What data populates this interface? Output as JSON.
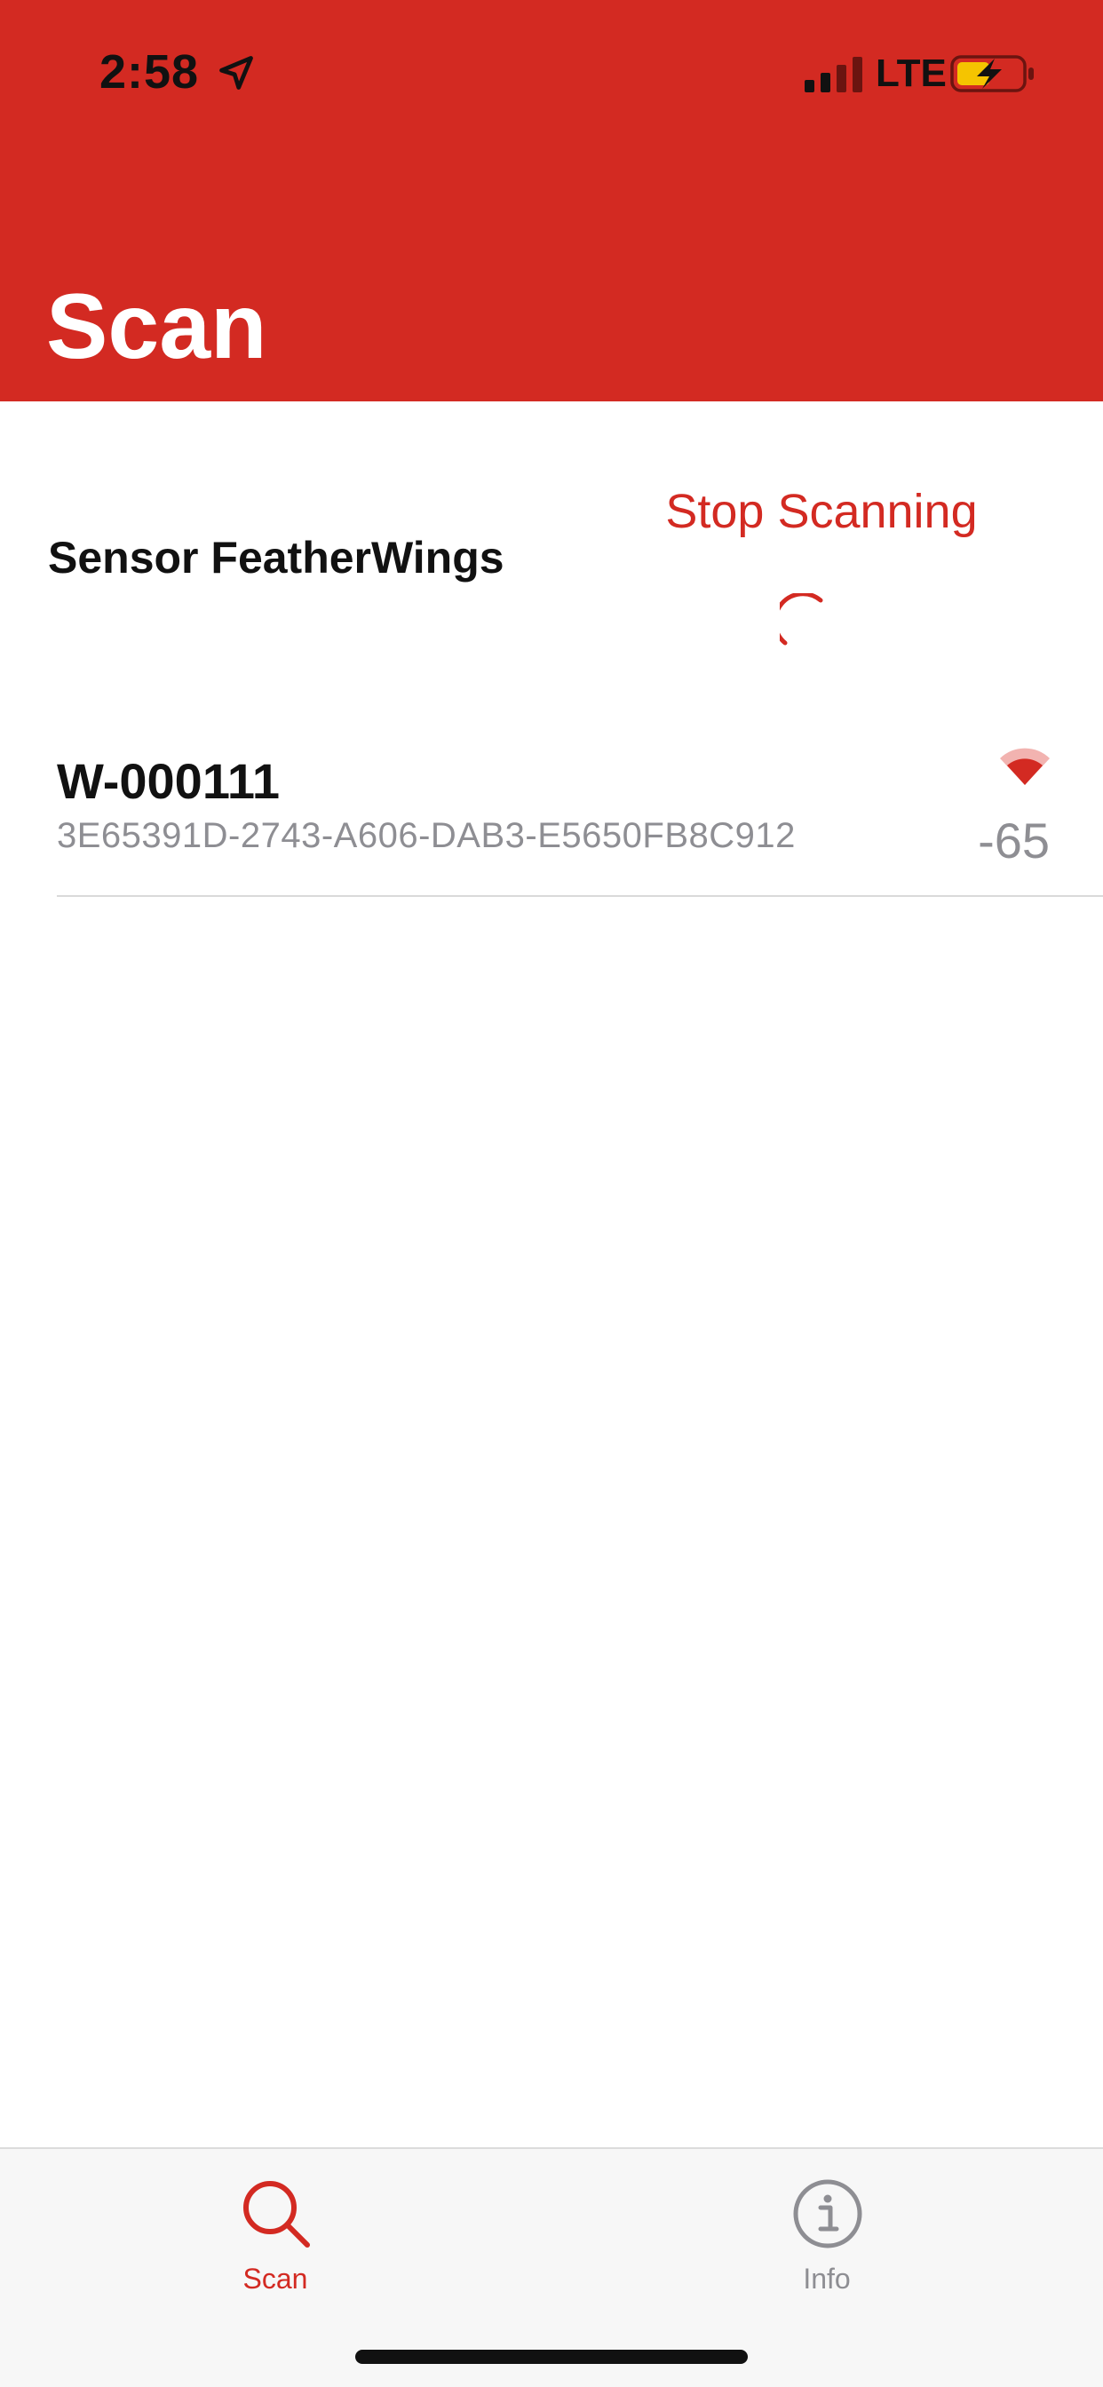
{
  "status_bar": {
    "time": "2:58",
    "network": "LTE",
    "icons": [
      "location-arrow-icon",
      "cellular-signal-icon",
      "battery-charging-icon"
    ]
  },
  "header": {
    "title": "Scan"
  },
  "section": {
    "label": "Sensor FeatherWings",
    "stop_button": "Stop Scanning",
    "spinner": "activity-spinner-icon"
  },
  "devices": [
    {
      "name": "W-000111",
      "uuid": "3E65391D-2743-A606-DAB3-E5650FB8C912",
      "rssi": "-65",
      "icon": "signal-strength-icon"
    }
  ],
  "tab_bar": {
    "tabs": [
      {
        "label": "Scan",
        "icon": "search-icon",
        "selected": true
      },
      {
        "label": "Info",
        "icon": "info-icon",
        "selected": false
      }
    ]
  },
  "colors": {
    "accent": "#d32a22",
    "secondary_text": "#8e8e93",
    "tab_bar_bg": "#f7f7f7"
  }
}
